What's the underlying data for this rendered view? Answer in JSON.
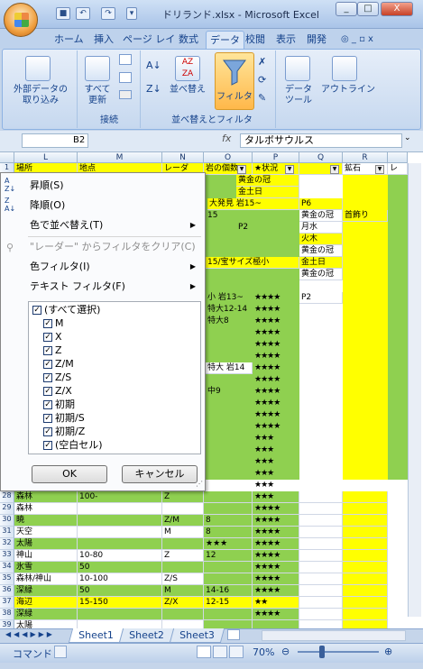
{
  "window": {
    "title": "ドリランド.xlsx - Microsoft Excel"
  },
  "tabs": [
    "ホーム",
    "挿入",
    "ページ レイ",
    "数式",
    "データ",
    "校閲",
    "表示",
    "開発"
  ],
  "ribbon": {
    "external_data": "外部データの\n取り込み",
    "refresh_all": "すべて\n更新",
    "connections_group": "接続",
    "sort": "並べ替え",
    "filter": "フィルタ",
    "sort_filter_group": "並べ替えとフィルタ",
    "data_tools": "データ\nツール",
    "outline": "アウトライン"
  },
  "formula_bar": {
    "cell_ref": "B2",
    "fx": "fx",
    "content": "タルボサウルス"
  },
  "columns": [
    "L",
    "M",
    "N",
    "O",
    "P",
    "Q",
    "R"
  ],
  "header_row": [
    "場所",
    "地点",
    "レーダ",
    "岩の個数",
    "★状況",
    "",
    ""
  ],
  "dropdown": {
    "sort_asc": "昇順(S)",
    "sort_desc": "降順(O)",
    "sort_by_color": "色で並べ替え(T)",
    "clear_filter": "\"レーダー\" からフィルタをクリア(C)",
    "color_filter": "色フィルタ(I)",
    "text_filter": "テキスト フィルタ(F)",
    "items": [
      "(すべて選択)",
      "M",
      "X",
      "Z",
      "Z/M",
      "Z/S",
      "Z/X",
      "初期",
      "初期/S",
      "初期/Z",
      "(空白セル)"
    ],
    "ok": "OK",
    "cancel": "キャンセル"
  },
  "rows": [
    {
      "n": "28",
      "L": "森林",
      "M": "100-",
      "N": "Z",
      "O": "",
      "P": "★★★"
    },
    {
      "n": "29",
      "L": "森林",
      "M": "",
      "N": "",
      "O": "",
      "P": "★★★★"
    },
    {
      "n": "30",
      "L": "暁",
      "M": "",
      "N": "Z/M",
      "O": "8",
      "P": "★★★★"
    },
    {
      "n": "31",
      "L": "天空",
      "M": "",
      "N": "M",
      "O": "8",
      "P": "★★★★"
    },
    {
      "n": "32",
      "L": "太陽",
      "M": "",
      "N": "",
      "O": "★★★",
      "P": "★★★★"
    },
    {
      "n": "33",
      "L": "神山",
      "M": "10-80",
      "N": "Z",
      "O": "12",
      "P": "★★★★"
    },
    {
      "n": "34",
      "L": "氷雪",
      "M": "50",
      "N": "",
      "O": "",
      "P": "★★★★"
    },
    {
      "n": "35",
      "L": "森林/神山",
      "M": "10-100",
      "N": "Z/S",
      "O": "",
      "P": "★★★★"
    },
    {
      "n": "36",
      "L": "深緑",
      "M": "50",
      "N": "M",
      "O": "14-16",
      "P": "★★★★"
    },
    {
      "n": "37",
      "L": "海辺",
      "M": "15-150",
      "N": "Z/X",
      "O": "12-15",
      "P": "★★"
    },
    {
      "n": "38",
      "L": "深緑",
      "M": "",
      "N": "",
      "O": "",
      "P": "★★★★"
    },
    {
      "n": "39",
      "L": "太陽",
      "M": "",
      "N": "",
      "O": "",
      "P": ""
    }
  ],
  "right_col_text": {
    "O2": "黄金の冠",
    "O3": "金土日",
    "O4": "大発見 岩15~",
    "P4": "P6",
    "O5": "15",
    "Q5": "黄金の冠",
    "R5": "首飾り",
    "O6": "P2",
    "Q6": "月水",
    "Q7": "火木",
    "O8": "15/宝サイズ極小",
    "Q8": "黄金の冠",
    "Q9": "金土日",
    "Q10": "黄金の冠",
    "O12": "小 岩13~",
    "P12": "P2",
    "O13": "特大12-14",
    "O14": "特大8",
    "O18": "特大 岩14",
    "O20": "中9",
    "R1": "鉱石",
    "S1": "レ"
  },
  "sheets": [
    "Sheet1",
    "Sheet2",
    "Sheet3"
  ],
  "status": {
    "mode": "コマンド",
    "zoom": "70%"
  }
}
